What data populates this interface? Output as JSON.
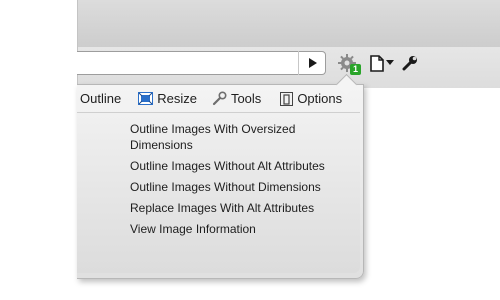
{
  "toolbar": {
    "extension_badge": "1",
    "icons": [
      "go-arrow-icon",
      "web-developer-gear-icon",
      "page-icon",
      "chevron-down-icon",
      "wrench-icon"
    ]
  },
  "menu": {
    "items": [
      {
        "label": "Outline"
      },
      {
        "label": "Resize",
        "icon": "resize-icon"
      },
      {
        "label": "Tools",
        "icon": "wrench-icon"
      },
      {
        "label": "Options",
        "icon": "options-icon"
      }
    ]
  },
  "submenu": {
    "items": [
      "Outline Images With Oversized Dimensions",
      "Outline Images Without Alt Attributes",
      "Outline Images Without Dimensions",
      "Replace Images With Alt Attributes",
      "View Image Information"
    ]
  },
  "colors": {
    "badge": "#2aa52a",
    "resize_icon": "#2a6fc9"
  }
}
